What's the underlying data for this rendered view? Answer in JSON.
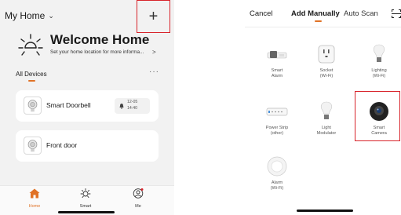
{
  "left": {
    "home_selector": "My Home",
    "add_button": "+",
    "welcome": {
      "title": "Welcome Home",
      "subtitle": "Set your home location for more informa...",
      "subtitle_arrow": ">"
    },
    "devices_tab": "All Devices",
    "more_menu": "···",
    "devices": [
      {
        "name": "Smart Doorbell",
        "badge_date": "12-05",
        "badge_time": "14:40"
      },
      {
        "name": "Front door"
      }
    ],
    "tabbar": [
      {
        "label": "Home",
        "icon": "home-icon",
        "active": true
      },
      {
        "label": "Smart",
        "icon": "sun-icon",
        "active": false
      },
      {
        "label": "Me",
        "icon": "profile-icon",
        "active": false
      }
    ]
  },
  "right": {
    "cancel": "Cancel",
    "tabs": [
      {
        "label": "Add Manually",
        "active": true
      },
      {
        "label": "Auto Scan",
        "active": false
      }
    ],
    "scan_icon": "scan-icon",
    "devices": [
      {
        "name": "Smart",
        "name2": "Alarm"
      },
      {
        "name": "Socket",
        "name2": "(Wi-Fi)"
      },
      {
        "name": "Lighting",
        "name2": "(Wi-Fi)"
      },
      {
        "name": "Power Strip",
        "name2": "(other)"
      },
      {
        "name": "Light",
        "name2": "Modulator"
      },
      {
        "name": "Smart",
        "name2": "Camera"
      },
      {
        "name": "Alarm",
        "name2": "(Wi-Fi)"
      }
    ]
  },
  "colors": {
    "accent": "#e07226",
    "highlight_box": "#d8232a",
    "left_background": "#f2f2f2",
    "card_background": "#ffffff"
  }
}
